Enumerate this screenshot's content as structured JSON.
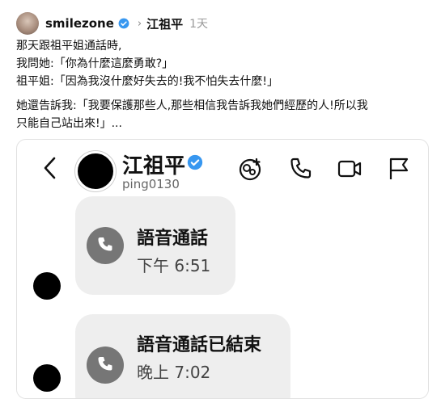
{
  "post": {
    "username": "smilezone",
    "target": "江祖平",
    "time": "1天",
    "lines": [
      "那天跟祖平姐通話時,",
      "我問她:「你為什麼這麼勇敢?」",
      "祖平姐:「因為我沒什麼好失去的!我不怕失去什麼!」"
    ],
    "lines2": [
      "她還告訴我:「我要保護那些人,那些相信我告訴我她們經歷的人!所以我",
      "只能自己站出來!」..."
    ]
  },
  "chat": {
    "name": "江祖平",
    "handle": "ping0130",
    "calls": [
      {
        "title": "語音通話",
        "time": "下午 6:51"
      },
      {
        "title": "語音通話已結束",
        "time": "晚上 7:02"
      }
    ]
  },
  "colors": {
    "verified": "#3797f0",
    "bubble": "#eeeeee",
    "call_icon": "#767676"
  }
}
